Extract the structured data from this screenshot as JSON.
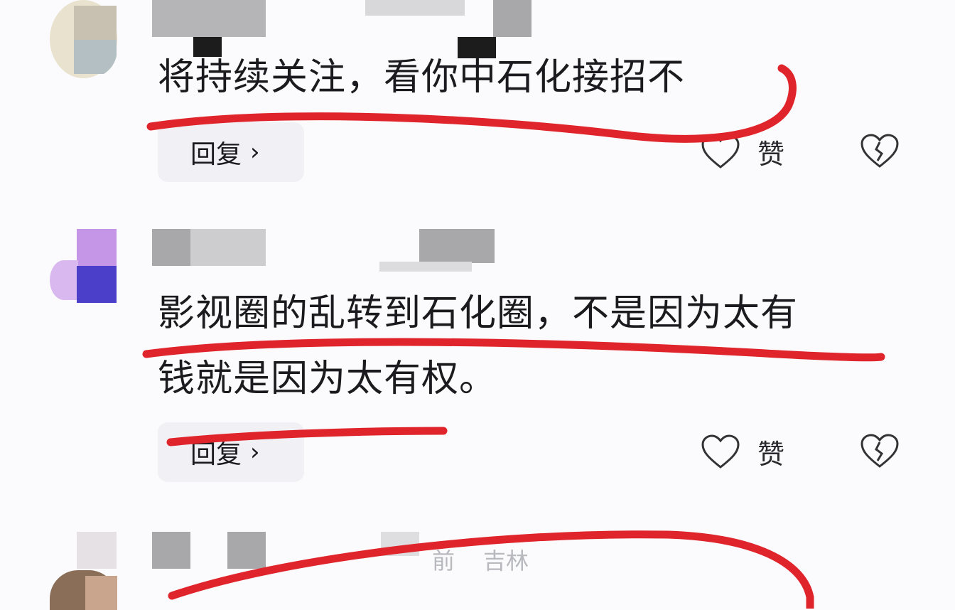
{
  "comments": [
    {
      "text": "将持续关注，看你中石化接招不",
      "reply_label": "回复",
      "like_label": "赞",
      "meta": ""
    },
    {
      "text_line1": "影视圈的乱转到石化圈，不是因为太有",
      "text_line2": "钱就是因为太有权。",
      "reply_label": "回复",
      "like_label": "赞",
      "meta": ""
    },
    {
      "meta_time": "前",
      "meta_location": "吉林",
      "text_partial": ""
    }
  ],
  "icons": {
    "like": "heart-outline-icon",
    "dislike": "broken-heart-icon",
    "chevron": "chevron-right-icon"
  },
  "colors": {
    "annotation_red": "#e0242b",
    "mosaic_gray": "#a8a8ab"
  }
}
